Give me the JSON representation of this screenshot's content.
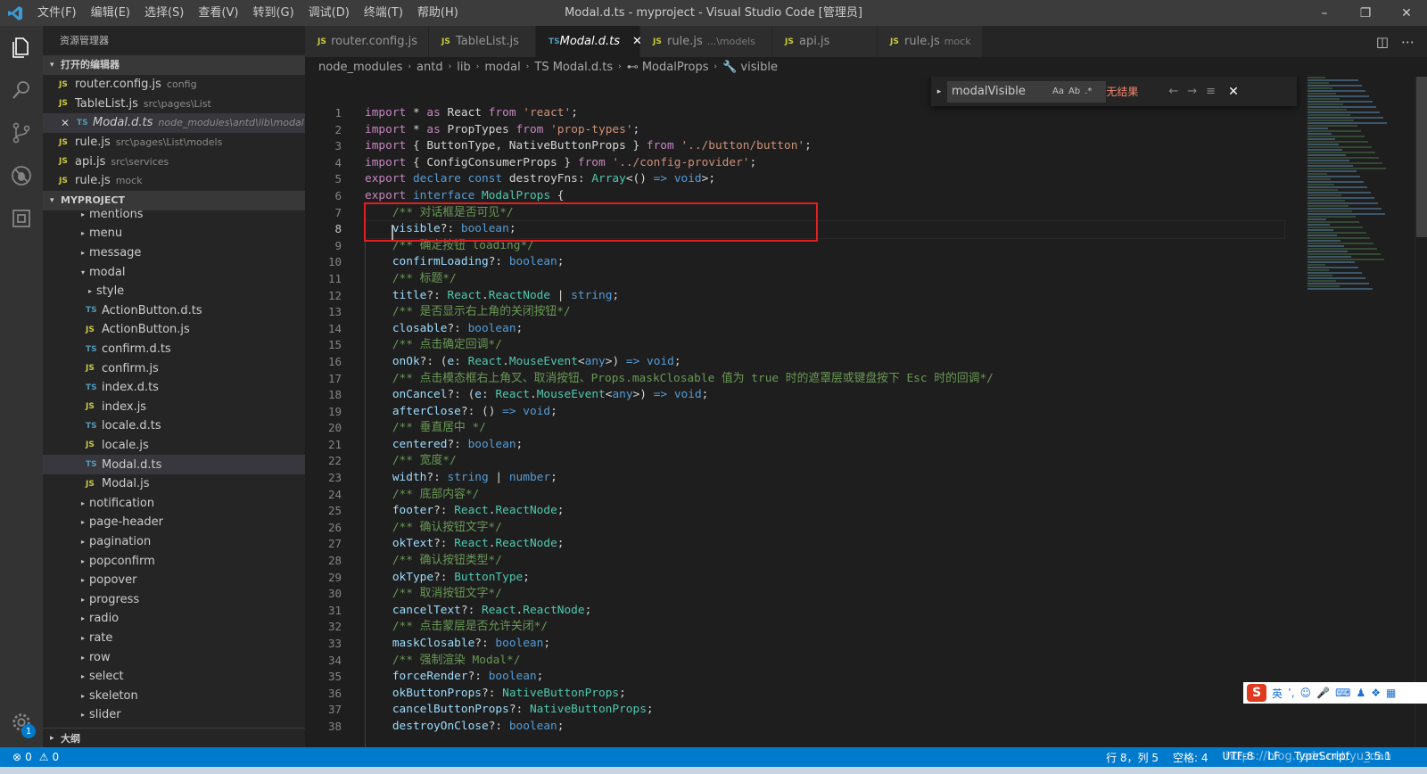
{
  "window": {
    "menu": [
      "文件(F)",
      "编辑(E)",
      "选择(S)",
      "查看(V)",
      "转到(G)",
      "调试(D)",
      "终端(T)",
      "帮助(H)"
    ],
    "title": "Modal.d.ts - myproject - Visual Studio Code [管理员]"
  },
  "sidebar": {
    "title": "资源管理器",
    "open_editors_label": "打开的编辑器",
    "open_editors": [
      {
        "icon": "JS",
        "name": "router.config.js",
        "hint": "config"
      },
      {
        "icon": "JS",
        "name": "TableList.js",
        "hint": "src\\pages\\List"
      },
      {
        "icon": "TS",
        "name": "Modal.d.ts",
        "hint": "node_modules\\antd\\lib\\modal"
      },
      {
        "icon": "JS",
        "name": "rule.js",
        "hint": "src\\pages\\List\\models"
      },
      {
        "icon": "JS",
        "name": "api.js",
        "hint": "src\\services"
      },
      {
        "icon": "JS",
        "name": "rule.js",
        "hint": "mock"
      }
    ],
    "project_label": "MYPROJECT",
    "tree": [
      {
        "name": "mentions",
        "icon": "▸",
        "indent": 0
      },
      {
        "name": "menu",
        "icon": "▸",
        "indent": 0
      },
      {
        "name": "message",
        "icon": "▸",
        "indent": 0
      },
      {
        "name": "modal",
        "icon": "▾",
        "indent": 0
      },
      {
        "name": "style",
        "icon": "▸",
        "indent": 1
      },
      {
        "name": "ActionButton.d.ts",
        "icon": "TS",
        "indent": 1
      },
      {
        "name": "ActionButton.js",
        "icon": "JS",
        "indent": 1
      },
      {
        "name": "confirm.d.ts",
        "icon": "TS",
        "indent": 1
      },
      {
        "name": "confirm.js",
        "icon": "JS",
        "indent": 1
      },
      {
        "name": "index.d.ts",
        "icon": "TS",
        "indent": 1
      },
      {
        "name": "index.js",
        "icon": "JS",
        "indent": 1
      },
      {
        "name": "locale.d.ts",
        "icon": "TS",
        "indent": 1
      },
      {
        "name": "locale.js",
        "icon": "JS",
        "indent": 1
      },
      {
        "name": "Modal.d.ts",
        "icon": "TS",
        "indent": 1
      },
      {
        "name": "Modal.js",
        "icon": "JS",
        "indent": 1
      },
      {
        "name": "notification",
        "icon": "▸",
        "indent": 0
      },
      {
        "name": "page-header",
        "icon": "▸",
        "indent": 0
      },
      {
        "name": "pagination",
        "icon": "▸",
        "indent": 0
      },
      {
        "name": "popconfirm",
        "icon": "▸",
        "indent": 0
      },
      {
        "name": "popover",
        "icon": "▸",
        "indent": 0
      },
      {
        "name": "progress",
        "icon": "▸",
        "indent": 0
      },
      {
        "name": "radio",
        "icon": "▸",
        "indent": 0
      },
      {
        "name": "rate",
        "icon": "▸",
        "indent": 0
      },
      {
        "name": "row",
        "icon": "▸",
        "indent": 0
      },
      {
        "name": "select",
        "icon": "▸",
        "indent": 0
      },
      {
        "name": "skeleton",
        "icon": "▸",
        "indent": 0
      },
      {
        "name": "slider",
        "icon": "▸",
        "indent": 0
      }
    ],
    "outline_label": "大纲",
    "settings_badge": "1"
  },
  "tabs": [
    {
      "icon": "JS",
      "name": "router.config.js",
      "hint": ""
    },
    {
      "icon": "JS",
      "name": "TableList.js",
      "hint": ""
    },
    {
      "icon": "TS",
      "name": "Modal.d.ts",
      "hint": ""
    },
    {
      "icon": "JS",
      "name": "rule.js",
      "hint": "...\\models"
    },
    {
      "icon": "JS",
      "name": "api.js",
      "hint": ""
    },
    {
      "icon": "JS",
      "name": "rule.js",
      "hint": "mock"
    }
  ],
  "breadcrumb": [
    "node_modules",
    "antd",
    "lib",
    "modal",
    "TS Modal.d.ts",
    "⊷ ModalProps",
    "🔧 visible"
  ],
  "find": {
    "query": "modalVisible",
    "options": [
      "Aa",
      "Ab",
      ".*"
    ],
    "status": "无结果"
  },
  "editor": {
    "current_line": 8,
    "lines": [
      [
        [
          "c",
          "import"
        ],
        [
          "p",
          " * "
        ],
        [
          "c",
          "as"
        ],
        [
          "p",
          " React "
        ],
        [
          "c",
          "from"
        ],
        [
          "p",
          " "
        ],
        [
          "s",
          "'react'"
        ],
        [
          "p",
          ";"
        ]
      ],
      [
        [
          "c",
          "import"
        ],
        [
          "p",
          " * "
        ],
        [
          "c",
          "as"
        ],
        [
          "p",
          " PropTypes "
        ],
        [
          "c",
          "from"
        ],
        [
          "p",
          " "
        ],
        [
          "s",
          "'prop-types'"
        ],
        [
          "p",
          ";"
        ]
      ],
      [
        [
          "c",
          "import"
        ],
        [
          "p",
          " { ButtonType, NativeButtonProps } "
        ],
        [
          "c",
          "from"
        ],
        [
          "p",
          " "
        ],
        [
          "s",
          "'../button/button'"
        ],
        [
          "p",
          ";"
        ]
      ],
      [
        [
          "c",
          "import"
        ],
        [
          "p",
          " { ConfigConsumerProps } "
        ],
        [
          "c",
          "from"
        ],
        [
          "p",
          " "
        ],
        [
          "s",
          "'../config-provider'"
        ],
        [
          "p",
          ";"
        ]
      ],
      [
        [
          "c",
          "export"
        ],
        [
          "p",
          " "
        ],
        [
          "k",
          "declare"
        ],
        [
          "p",
          " "
        ],
        [
          "k",
          "const"
        ],
        [
          "p",
          " destroyFns: "
        ],
        [
          "t",
          "Array"
        ],
        [
          "p",
          "<() "
        ],
        [
          "k",
          "=>"
        ],
        [
          "p",
          " "
        ],
        [
          "k",
          "void"
        ],
        [
          "p",
          ">;"
        ]
      ],
      [
        [
          "c",
          "export"
        ],
        [
          "p",
          " "
        ],
        [
          "k",
          "interface"
        ],
        [
          "p",
          " "
        ],
        [
          "t",
          "ModalProps"
        ],
        [
          "p",
          " {"
        ]
      ],
      [
        [
          "p",
          "    "
        ],
        [
          "cm",
          "/** 对话框是否可见*/"
        ]
      ],
      [
        [
          "p",
          "    "
        ],
        [
          "v",
          "visible"
        ],
        [
          "p",
          "?: "
        ],
        [
          "k",
          "boolean"
        ],
        [
          "p",
          ";"
        ]
      ],
      [
        [
          "p",
          "    "
        ],
        [
          "cm",
          "/** 确定按钮 loading*/"
        ]
      ],
      [
        [
          "p",
          "    "
        ],
        [
          "v",
          "confirmLoading"
        ],
        [
          "p",
          "?: "
        ],
        [
          "k",
          "boolean"
        ],
        [
          "p",
          ";"
        ]
      ],
      [
        [
          "p",
          "    "
        ],
        [
          "cm",
          "/** 标题*/"
        ]
      ],
      [
        [
          "p",
          "    "
        ],
        [
          "v",
          "title"
        ],
        [
          "p",
          "?: "
        ],
        [
          "t",
          "React"
        ],
        [
          "p",
          "."
        ],
        [
          "t",
          "ReactNode"
        ],
        [
          "p",
          " | "
        ],
        [
          "k",
          "string"
        ],
        [
          "p",
          ";"
        ]
      ],
      [
        [
          "p",
          "    "
        ],
        [
          "cm",
          "/** 是否显示右上角的关闭按钮*/"
        ]
      ],
      [
        [
          "p",
          "    "
        ],
        [
          "v",
          "closable"
        ],
        [
          "p",
          "?: "
        ],
        [
          "k",
          "boolean"
        ],
        [
          "p",
          ";"
        ]
      ],
      [
        [
          "p",
          "    "
        ],
        [
          "cm",
          "/** 点击确定回调*/"
        ]
      ],
      [
        [
          "p",
          "    "
        ],
        [
          "v",
          "onOk"
        ],
        [
          "p",
          "?: ("
        ],
        [
          "v",
          "e"
        ],
        [
          "p",
          ": "
        ],
        [
          "t",
          "React"
        ],
        [
          "p",
          "."
        ],
        [
          "t",
          "MouseEvent"
        ],
        [
          "p",
          "<"
        ],
        [
          "k",
          "any"
        ],
        [
          "p",
          ">) "
        ],
        [
          "k",
          "=>"
        ],
        [
          "p",
          " "
        ],
        [
          "k",
          "void"
        ],
        [
          "p",
          ";"
        ]
      ],
      [
        [
          "p",
          "    "
        ],
        [
          "cm",
          "/** 点击模态框右上角叉、取消按钮、Props.maskClosable 值为 true 时的遮罩层或键盘按下 Esc 时的回调*/"
        ]
      ],
      [
        [
          "p",
          "    "
        ],
        [
          "v",
          "onCancel"
        ],
        [
          "p",
          "?: ("
        ],
        [
          "v",
          "e"
        ],
        [
          "p",
          ": "
        ],
        [
          "t",
          "React"
        ],
        [
          "p",
          "."
        ],
        [
          "t",
          "MouseEvent"
        ],
        [
          "p",
          "<"
        ],
        [
          "k",
          "any"
        ],
        [
          "p",
          ">) "
        ],
        [
          "k",
          "=>"
        ],
        [
          "p",
          " "
        ],
        [
          "k",
          "void"
        ],
        [
          "p",
          ";"
        ]
      ],
      [
        [
          "p",
          "    "
        ],
        [
          "v",
          "afterClose"
        ],
        [
          "p",
          "?: () "
        ],
        [
          "k",
          "=>"
        ],
        [
          "p",
          " "
        ],
        [
          "k",
          "void"
        ],
        [
          "p",
          ";"
        ]
      ],
      [
        [
          "p",
          "    "
        ],
        [
          "cm",
          "/** 垂直居中 */"
        ]
      ],
      [
        [
          "p",
          "    "
        ],
        [
          "v",
          "centered"
        ],
        [
          "p",
          "?: "
        ],
        [
          "k",
          "boolean"
        ],
        [
          "p",
          ";"
        ]
      ],
      [
        [
          "p",
          "    "
        ],
        [
          "cm",
          "/** 宽度*/"
        ]
      ],
      [
        [
          "p",
          "    "
        ],
        [
          "v",
          "width"
        ],
        [
          "p",
          "?: "
        ],
        [
          "k",
          "string"
        ],
        [
          "p",
          " | "
        ],
        [
          "k",
          "number"
        ],
        [
          "p",
          ";"
        ]
      ],
      [
        [
          "p",
          "    "
        ],
        [
          "cm",
          "/** 底部内容*/"
        ]
      ],
      [
        [
          "p",
          "    "
        ],
        [
          "v",
          "footer"
        ],
        [
          "p",
          "?: "
        ],
        [
          "t",
          "React"
        ],
        [
          "p",
          "."
        ],
        [
          "t",
          "ReactNode"
        ],
        [
          "p",
          ";"
        ]
      ],
      [
        [
          "p",
          "    "
        ],
        [
          "cm",
          "/** 确认按钮文字*/"
        ]
      ],
      [
        [
          "p",
          "    "
        ],
        [
          "v",
          "okText"
        ],
        [
          "p",
          "?: "
        ],
        [
          "t",
          "React"
        ],
        [
          "p",
          "."
        ],
        [
          "t",
          "ReactNode"
        ],
        [
          "p",
          ";"
        ]
      ],
      [
        [
          "p",
          "    "
        ],
        [
          "cm",
          "/** 确认按钮类型*/"
        ]
      ],
      [
        [
          "p",
          "    "
        ],
        [
          "v",
          "okType"
        ],
        [
          "p",
          "?: "
        ],
        [
          "t",
          "ButtonType"
        ],
        [
          "p",
          ";"
        ]
      ],
      [
        [
          "p",
          "    "
        ],
        [
          "cm",
          "/** 取消按钮文字*/"
        ]
      ],
      [
        [
          "p",
          "    "
        ],
        [
          "v",
          "cancelText"
        ],
        [
          "p",
          "?: "
        ],
        [
          "t",
          "React"
        ],
        [
          "p",
          "."
        ],
        [
          "t",
          "ReactNode"
        ],
        [
          "p",
          ";"
        ]
      ],
      [
        [
          "p",
          "    "
        ],
        [
          "cm",
          "/** 点击蒙层是否允许关闭*/"
        ]
      ],
      [
        [
          "p",
          "    "
        ],
        [
          "v",
          "maskClosable"
        ],
        [
          "p",
          "?: "
        ],
        [
          "k",
          "boolean"
        ],
        [
          "p",
          ";"
        ]
      ],
      [
        [
          "p",
          "    "
        ],
        [
          "cm",
          "/** 强制渲染 Modal*/"
        ]
      ],
      [
        [
          "p",
          "    "
        ],
        [
          "v",
          "forceRender"
        ],
        [
          "p",
          "?: "
        ],
        [
          "k",
          "boolean"
        ],
        [
          "p",
          ";"
        ]
      ],
      [
        [
          "p",
          "    "
        ],
        [
          "v",
          "okButtonProps"
        ],
        [
          "p",
          "?: "
        ],
        [
          "t",
          "NativeButtonProps"
        ],
        [
          "p",
          ";"
        ]
      ],
      [
        [
          "p",
          "    "
        ],
        [
          "v",
          "cancelButtonProps"
        ],
        [
          "p",
          "?: "
        ],
        [
          "t",
          "NativeButtonProps"
        ],
        [
          "p",
          ";"
        ]
      ],
      [
        [
          "p",
          "    "
        ],
        [
          "v",
          "destroyOnClose"
        ],
        [
          "p",
          "?: "
        ],
        [
          "k",
          "boolean"
        ],
        [
          "p",
          ";"
        ]
      ]
    ]
  },
  "ime": {
    "logo": "S",
    "lang": "英"
  },
  "statusbar": {
    "errors": "0",
    "warnings": "0",
    "position": "行 8，列 5",
    "spaces": "空格: 4",
    "encoding": "UTF-8",
    "eol": "LF",
    "language": "TypeScript",
    "version": "3.5.1"
  },
  "watermark": "https://blog.csdn.net/yu_nan",
  "colors": {
    "accent": "#007acc",
    "highlight_box": "#e02020",
    "find_status": "#f48771"
  }
}
